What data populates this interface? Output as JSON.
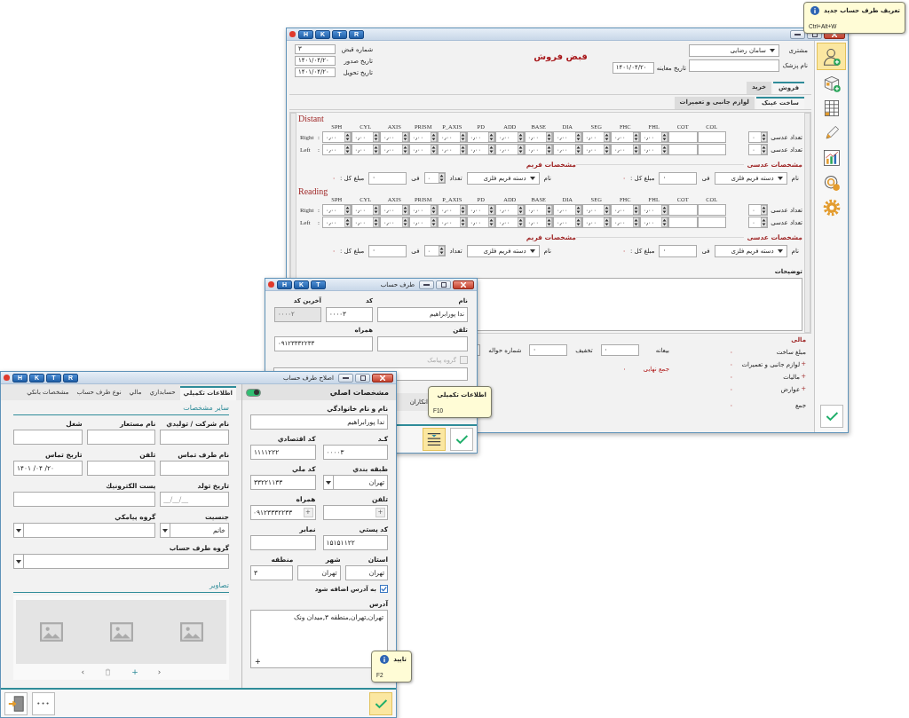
{
  "tooltips": [
    {
      "title": "تعریف طرف حساب جدید",
      "shortcut": "Ctrl+Alt+W"
    },
    {
      "title": "اطلاعات تکمیلی",
      "shortcut": "F10"
    },
    {
      "title": "تایید",
      "shortcut": "F2"
    }
  ],
  "sales_window": {
    "title_buttons": [
      "R",
      "T",
      "K",
      "H"
    ],
    "heading": "قبض فروش",
    "customer": {
      "label": "مشتری",
      "value": "سامان رضایی"
    },
    "doctor": {
      "label": "نام پزشک"
    },
    "exam_date": {
      "label": "تاریخ معاینه",
      "value": "۱۴۰۱/۰۴/۲۰"
    },
    "receipt_fields": [
      {
        "label": "شماره قبض",
        "value": "۳"
      },
      {
        "label": "تاریخ صدور",
        "value": "۱۴۰۱/۰۴/۲۰"
      },
      {
        "label": "تاریخ تحویل",
        "value": "۱۴۰۱/۰۴/۲۰"
      }
    ],
    "tabs": [
      {
        "label": "فروش",
        "selected": true
      },
      {
        "label": "خرید",
        "selected": false
      }
    ],
    "subtabs": [
      {
        "label": "ساخت عینک",
        "selected": true
      },
      {
        "label": "لوازم جانبی و تعمیرات",
        "selected": false
      }
    ],
    "sections": [
      {
        "title": "Distant",
        "columns": [
          "COL",
          "COT",
          "FHL",
          "FHC",
          "SEG",
          "DIA",
          "BASE",
          "ADD",
          "PD",
          "P_AXIS",
          "PRISM",
          "AXIS",
          "CYL",
          "SPH"
        ],
        "rows": [
          {
            "label": "Right",
            "colon": ":",
            "values": [
              "۰٫۰۰",
              "۰٫۰۰",
              "۰٫۰۰",
              "۰٫۰۰",
              "۰٫۰۰",
              "۰٫۰۰",
              "۰٫۰۰",
              "۰٫۰۰",
              "۰٫۰۰",
              "۰٫۰۰",
              "۰٫۰۰",
              "۰٫۰۰"
            ],
            "count_label": "تعداد عدسی",
            "count": "۰"
          },
          {
            "label": "Left",
            "colon": ":",
            "values": [
              "۰٫۰۰",
              "۰٫۰۰",
              "۰٫۰۰",
              "۰٫۰۰",
              "۰٫۰۰",
              "۰٫۰۰",
              "۰٫۰۰",
              "۰٫۰۰",
              "۰٫۰۰",
              "۰٫۰۰",
              "۰٫۰۰",
              "۰٫۰۰"
            ],
            "count_label": "تعداد عدسی",
            "count": "۰"
          }
        ],
        "lens": {
          "title": "مشخصات عدسی",
          "name_label": "نام",
          "name": "دسته فریم فلزی",
          "price_label": "فی",
          "price": "۰",
          "total_label": "مبلغ کل :",
          "total": "۰"
        },
        "frame": {
          "title": "مشخصات فریم",
          "name_label": "نام",
          "name": "دسته فریم فلزی",
          "qty_label": "تعداد",
          "qty": "۰",
          "price_label": "فی",
          "price": "۰",
          "total_label": "مبلغ کل :",
          "total": "۰"
        }
      },
      {
        "title": "Reading",
        "columns": [
          "COL",
          "COT",
          "FHL",
          "FHC",
          "SEG",
          "DIA",
          "BASE",
          "ADD",
          "PD",
          "P_AXIS",
          "PRISM",
          "AXIS",
          "CYL",
          "SPH"
        ],
        "rows": [
          {
            "label": "Right",
            "colon": ":",
            "values": [
              "۰٫۰۰",
              "۰٫۰۰",
              "۰٫۰۰",
              "۰٫۰۰",
              "۰٫۰۰",
              "۰٫۰۰",
              "۰٫۰۰",
              "۰٫۰۰",
              "۰٫۰۰",
              "۰٫۰۰",
              "۰٫۰۰",
              "۰٫۰۰"
            ],
            "count_label": "تعداد عدسی",
            "count": "۰"
          },
          {
            "label": "Left",
            "colon": ":",
            "values": [
              "۰٫۰۰",
              "۰٫۰۰",
              "۰٫۰۰",
              "۰٫۰۰",
              "۰٫۰۰",
              "۰٫۰۰",
              "۰٫۰۰",
              "۰٫۰۰",
              "۰٫۰۰",
              "۰٫۰۰",
              "۰٫۰۰",
              "۰٫۰۰"
            ],
            "count_label": "تعداد عدسی",
            "count": "۰"
          }
        ],
        "lens": {
          "title": "مشخصات عدسی",
          "name_label": "نام",
          "name": "دسته فریم فلزی",
          "price_label": "فی",
          "price": "۰",
          "total_label": "مبلغ کل :",
          "total": "۰"
        },
        "frame": {
          "title": "مشخصات فریم",
          "name_label": "نام",
          "name": "دسته فریم فلزی",
          "qty_label": "تعداد",
          "qty": "۰",
          "price_label": "فی",
          "price": "۰",
          "total_label": "مبلغ کل :",
          "total": "۰"
        }
      }
    ],
    "notes_label": "توضیحات",
    "finance": {
      "title": "مالی",
      "items": [
        {
          "label": "مبلغ ساخت",
          "value": "۰"
        },
        {
          "label": "لوازم جانبی و تعمیرات",
          "value": "۰",
          "sign": "+"
        },
        {
          "label": "مالیات",
          "value": "۰",
          "sign": "+"
        },
        {
          "label": "عوارض",
          "value": "۰",
          "sign": "+"
        },
        {
          "label": "جمع",
          "value": "۰"
        }
      ]
    },
    "payments": [
      {
        "label": "بیعانه",
        "value": "۰"
      },
      {
        "label": "تخفیف",
        "value": "۰"
      },
      {
        "label": "شماره حواله"
      }
    ],
    "grand_total": {
      "label": "جمع نهایی",
      "value": "۰"
    },
    "sidebar": [
      {
        "highlighted": true
      },
      {
        "highlighted": false
      },
      {
        "highlighted": false
      },
      {
        "highlighted": false
      },
      {
        "highlighted": false
      },
      {
        "highlighted": false
      },
      {
        "highlighted": false
      }
    ]
  },
  "account_window": {
    "title_buttons": [
      "T",
      "K",
      "H"
    ],
    "title": "طرف حساب",
    "fields": [
      {
        "label": "نام",
        "value": "ندا پورابراهیم",
        "disabled": false
      },
      {
        "label": "کد",
        "value": "۰۰۰۰۳",
        "disabled": false
      },
      {
        "label": "آخرین کد",
        "value": "۰۰۰۰۲",
        "disabled": true
      },
      {
        "label": "تلفن",
        "disabled": false
      },
      {
        "label": "همراه",
        "value": "۰۹۱۲۳۳۳۲۲۳۳",
        "disabled": false
      }
    ],
    "sms_group": {
      "label": "گروه پیامک",
      "checked": false,
      "disabled": true
    },
    "tab": "انکاران",
    "buttons": [
      {
        "highlighted": false
      },
      {
        "highlighted": true
      }
    ]
  },
  "edit_window": {
    "title_buttons": [
      "R",
      "T",
      "K",
      "H"
    ],
    "title": "اصلاح طرف حساب",
    "main": {
      "header": "مشخصات اصلي",
      "toggle_on": true,
      "fields": [
        {
          "label": "نام و نام خانوادگي",
          "value": "ندا پورابراهیم",
          "kind": "text"
        },
        {
          "label": "كـد",
          "value": "۰۰۰۰۳",
          "kind": "text"
        },
        {
          "label": "کد اقتصادي",
          "value": "۱۱۱۱۲۲۲",
          "kind": "text"
        },
        {
          "label": "طبقه بندي",
          "value": "تهران",
          "kind": "dropdown"
        },
        {
          "label": "کد ملي",
          "value": "۳۳۲۲۱۱۳۳",
          "kind": "text"
        },
        {
          "label": "تلفن",
          "kind": "phone",
          "button": "+"
        },
        {
          "label": "همراه",
          "value": "۰۹۱۲۳۳۳۲۲۳۳",
          "kind": "phone",
          "button": "+"
        },
        {
          "label": "کد پستي",
          "value": "۱۵۱۵۱۱۲۲",
          "kind": "text"
        },
        {
          "label": "نمابر",
          "kind": "text"
        },
        {
          "label": "استان",
          "value": "تهران",
          "kind": "text"
        },
        {
          "label": "شهر",
          "value": "تهران",
          "kind": "text"
        },
        {
          "label": "منطقه",
          "value": "۳",
          "kind": "text"
        }
      ],
      "add_to_address": {
        "label": "به آدرس اضافه شود",
        "checked": true
      },
      "address": {
        "label": "آدرس",
        "value": "تهران,تهران,منطقه ۳,میدان ونک",
        "button": "+"
      }
    },
    "tabs": [
      {
        "label": "اطلاعات تكميلي",
        "selected": true
      },
      {
        "label": "حسابداري",
        "selected": false
      },
      {
        "label": "مالي",
        "selected": false
      },
      {
        "label": "نوع طرف حساب",
        "selected": false
      },
      {
        "label": "مشخصات بانكي",
        "selected": false
      }
    ],
    "details": {
      "title": "ساير مشخصات",
      "fields": [
        {
          "label": "نام شرکت / توليدي",
          "kind": "text"
        },
        {
          "label": "نام مستعار",
          "kind": "text"
        },
        {
          "label": "شغل",
          "kind": "text"
        },
        {
          "label": "نام طرف تماس",
          "kind": "text"
        },
        {
          "label": "تلفن",
          "kind": "text"
        },
        {
          "label": "تاريخ تماس",
          "value": "۱۴۰۱ /۰۴ /۲۰",
          "kind": "text"
        },
        {
          "label": "تاريخ تولد",
          "placeholder": "__/__/__",
          "kind": "text"
        },
        {
          "label": "پست الكترونيك",
          "kind": "text"
        },
        {
          "label": "جنسيت",
          "value": "خانم",
          "kind": "dropdown"
        },
        {
          "label": "گروه پيامكي",
          "kind": "dropdown"
        },
        {
          "label": "گروه طرف حساب",
          "kind": "dropdown"
        }
      ]
    },
    "images": {
      "title": "تصاوير",
      "placeholders": [
        {
          "empty": true
        },
        {
          "empty": true
        },
        {
          "empty": true
        }
      ],
      "prev": "‹",
      "add": "+",
      "next": "›"
    },
    "more_button": "•••",
    "confirm_highlighted": true
  }
}
